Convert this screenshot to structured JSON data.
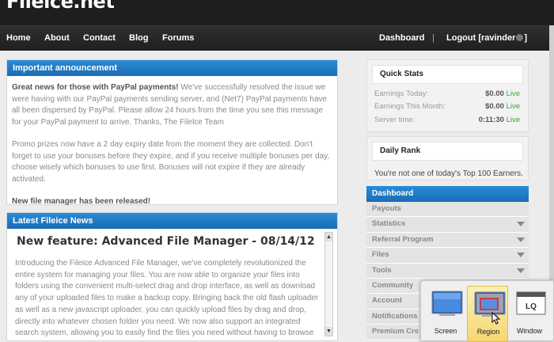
{
  "site": {
    "logo": "Filelce.net"
  },
  "nav": {
    "left": [
      "Home",
      "About",
      "Contact",
      "Blog",
      "Forums"
    ],
    "dashboard": "Dashboard",
    "separator": "|",
    "logout": "Logout [ravinder",
    "logout_end": "]"
  },
  "announcement": {
    "title": "Important announcement",
    "p1_bold": "Great news for those with PayPal payments!",
    "p1_rest": " We've successfully resolved the issue we were having with our PayPal payments sending server, and (Net7) PayPal payments have all been dispersed by PayPal. Please allow 24 hours from the time you see this message for your PayPal payment to arrive. Thanks, The Filelce Team",
    "p2": "Promo prizes now have a 2 day expiry date from the moment they are collected. Don't forget to use your bonuses before they expire, and if you receive multiple bonuses per day, choose wisely which bonuses to use first. Bonuses will not expire if they are already activated.",
    "p3_bold": "New file manager has been released!"
  },
  "news": {
    "title": "Latest Fileice News",
    "headline": "New feature: Advanced File Manager - 08/14/12",
    "body": "Introducing the Fileice Advanced File Manager, we've completely revolutionized the entire system for managing your files. You are now able to organize your files into folders using the convenient multi-select drag and drop interface, as well as download any of your uploaded files to make a backup copy. Bringing back the old flash uploader as well as a new javascript uploader, you can quickly upload files by drag and drop, directly into whatever chosen folder you need. We now also support an integrated search system, allowing you to easily find the files you need without having to browse through all of them."
  },
  "quick_stats": {
    "title": "Quick Stats",
    "rows": [
      {
        "label": "Earnings Today:",
        "value": "$0.00",
        "status": "Live"
      },
      {
        "label": "Earnings This Month:",
        "value": "$0.00",
        "status": "Live"
      },
      {
        "label": "Server time:",
        "value": "0:11:30",
        "status": "Live"
      }
    ]
  },
  "daily_rank": {
    "title": "Daily Rank",
    "text": "You're not one of today's Top 100 Earners."
  },
  "dashboard_menu": {
    "title": "Dashboard",
    "items": [
      {
        "label": "Payouts",
        "arrow": false
      },
      {
        "label": "Statistics",
        "arrow": true
      },
      {
        "label": "Referral Program",
        "arrow": true
      },
      {
        "label": "Files",
        "arrow": true
      },
      {
        "label": "Tools",
        "arrow": true
      },
      {
        "label": "Community",
        "arrow": false
      },
      {
        "label": "Account",
        "arrow": false
      },
      {
        "label": "Notifications",
        "arrow": false
      },
      {
        "label": "Premium Cre",
        "arrow": false
      }
    ]
  },
  "capture_popup": {
    "options": [
      {
        "label": "Screen",
        "icon": "monitor-icon",
        "selected": false
      },
      {
        "label": "Region",
        "icon": "region-select-icon",
        "selected": true
      },
      {
        "label": "Window",
        "icon": "window-icon",
        "selected": false
      }
    ],
    "window_icon_text": "LQ"
  },
  "colors": {
    "accent": "#1a6cb5",
    "live": "#3aa43a",
    "header": "#1e1e1e"
  }
}
